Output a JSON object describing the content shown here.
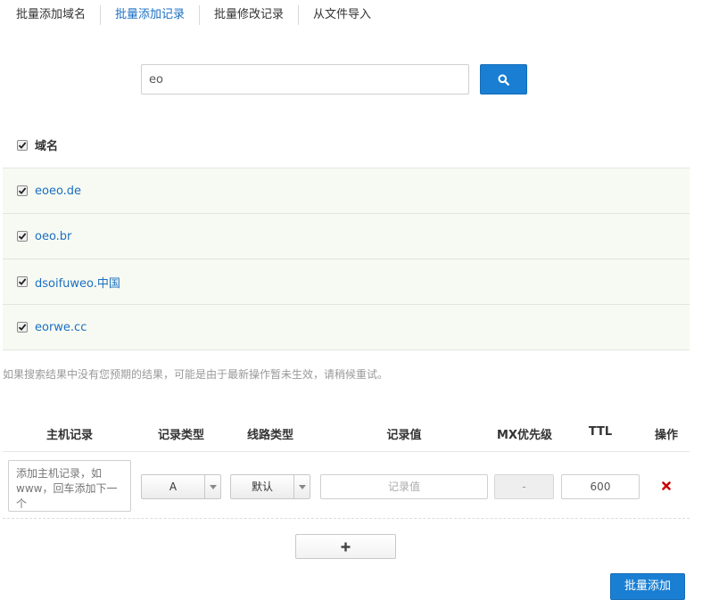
{
  "tabs": [
    {
      "label": "批量添加域名",
      "active": false
    },
    {
      "label": "批量添加记录",
      "active": true
    },
    {
      "label": "批量修改记录",
      "active": false
    },
    {
      "label": "从文件导入",
      "active": false
    }
  ],
  "search": {
    "value": "eo",
    "icon": "search-icon"
  },
  "domain_list": {
    "header_label": "域名",
    "items": [
      {
        "name": "eoeo.de",
        "checked": true
      },
      {
        "name": "oeo.br",
        "checked": true
      },
      {
        "name": "dsoifuweo.中国",
        "checked": true
      },
      {
        "name": "eorwe.cc",
        "checked": true
      }
    ]
  },
  "hint": "如果搜索结果中没有您预期的结果，可能是由于最新操作暂未生效，请稍候重试。",
  "records_table": {
    "columns": [
      "主机记录",
      "记录类型",
      "线路类型",
      "记录值",
      "MX优先级",
      "TTL",
      "操作"
    ],
    "row": {
      "host_placeholder": "添加主机记录，如www，回车添加下一个",
      "record_type": "A",
      "line_type": "默认",
      "value_placeholder": "记录值",
      "mx": "-",
      "ttl": "600"
    }
  },
  "add_row_label": "+",
  "submit_label": "批量添加",
  "colors": {
    "accent": "#1a7fd3",
    "link": "#1a6fc2",
    "delete": "#cc0000",
    "row_bg": "#f7faf2"
  }
}
